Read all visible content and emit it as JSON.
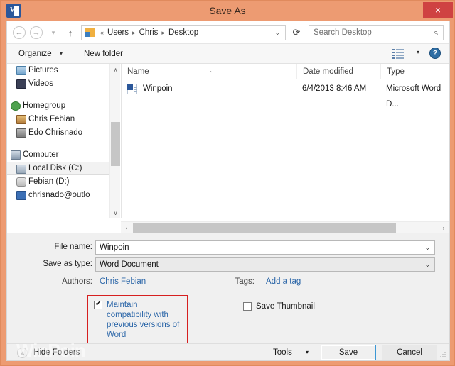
{
  "window": {
    "title": "Save As",
    "app_icon": "word-icon",
    "close_label": "×",
    "accent_color": "#ed9b72",
    "close_color": "#cf4242"
  },
  "navbar": {
    "back_icon": "←",
    "forward_icon": "→",
    "recent_icon": "▾",
    "up_icon": "↑",
    "breadcrumb_prefix": "«",
    "breadcrumb": [
      "Users",
      "Chris",
      "Desktop"
    ],
    "breadcrumb_separator": "▸",
    "address_dropdown_icon": "⌄",
    "refresh_icon": "⟳",
    "search_placeholder": "Search Desktop",
    "search_value": "",
    "search_icon": "⌕"
  },
  "commandbar": {
    "organize_label": "Organize",
    "organize_arrow": "▾",
    "new_folder_label": "New folder",
    "view_arrow": "▾",
    "help_label": "?"
  },
  "navigation_pane": {
    "items": [
      {
        "label": "Pictures",
        "icon": "pictures-icon",
        "icon_class": "ic-pictures",
        "indent": true,
        "selected": false
      },
      {
        "label": "Videos",
        "icon": "videos-icon",
        "icon_class": "ic-videos",
        "indent": true,
        "selected": false
      },
      {
        "label": "Homegroup",
        "icon": "homegroup-icon",
        "icon_class": "ic-homegroup",
        "indent": false,
        "selected": false
      },
      {
        "label": "Chris Febian",
        "icon": "user-icon",
        "icon_class": "ic-chris",
        "indent": true,
        "selected": false
      },
      {
        "label": "Edo Chrisnado",
        "icon": "user-icon",
        "icon_class": "ic-edo",
        "indent": true,
        "selected": false
      },
      {
        "label": "Computer",
        "icon": "computer-icon",
        "icon_class": "ic-computer",
        "indent": false,
        "selected": false
      },
      {
        "label": "Local Disk (C:)",
        "icon": "harddisk-icon",
        "icon_class": "ic-localdisk",
        "indent": true,
        "selected": true
      },
      {
        "label": "Febian (D:)",
        "icon": "drive-icon",
        "icon_class": "ic-febian",
        "indent": true,
        "selected": false
      },
      {
        "label": "chrisnado@outlo",
        "icon": "outlook-icon",
        "icon_class": "ic-outlook",
        "indent": true,
        "selected": false
      }
    ],
    "scroll_up_icon": "∧",
    "scroll_down_icon": "∨"
  },
  "file_list": {
    "columns": [
      "Name",
      "Date modified",
      "Type"
    ],
    "sort_caret": "⌃",
    "rows": [
      {
        "name": "Winpoin",
        "date_modified": "6/4/2013 8:46 AM",
        "type": "Microsoft Word D...",
        "icon": "word-document-icon"
      }
    ],
    "hscroll_left_icon": "‹",
    "hscroll_right_icon": "›"
  },
  "form": {
    "file_name_label": "File name:",
    "file_name_value": "Winpoin",
    "save_as_type_label": "Save as type:",
    "save_as_type_value": "Word Document",
    "dropdown_icon": "⌄",
    "authors_label": "Authors:",
    "authors_value": "Chris Febian",
    "tags_label": "Tags:",
    "tags_value": "Add a tag",
    "maintain_compat_label": "Maintain compatibility with previous versions of Word",
    "maintain_compat_checked": true,
    "save_thumbnail_label": "Save Thumbnail",
    "save_thumbnail_checked": false,
    "highlight_color": "#d61f1f"
  },
  "footer": {
    "hide_folders_label": "Hide Folders",
    "hide_folders_icon": "▲",
    "tools_label": "Tools",
    "tools_arrow": "▾",
    "save_label": "Save",
    "cancel_label": "Cancel"
  },
  "watermark": {
    "text": "WinPoin"
  }
}
